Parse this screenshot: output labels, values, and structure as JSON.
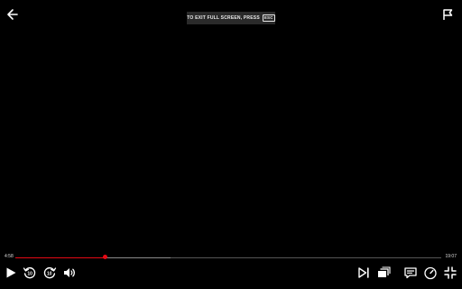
{
  "top_bar": {
    "back_icon": "arrow-left-icon",
    "report_icon": "flag-icon"
  },
  "exit_banner": {
    "text": "TO EXIT FULL SCREEN, PRESS",
    "key": "ESC"
  },
  "timeline": {
    "elapsed": "4:58",
    "remaining": "19:07",
    "played_fraction": 0.21,
    "buffered_fraction": 0.365,
    "colors": {
      "played": "#e50914",
      "buffered": "#8a8a8a",
      "track": "#555555"
    }
  },
  "controls": {
    "left": [
      "play-icon",
      "rewind-10-icon",
      "forward-10-icon",
      "volume-icon"
    ],
    "right": [
      "next-episode-icon",
      "episodes-icon",
      "subtitles-icon",
      "playback-speed-icon",
      "exit-fullscreen-icon"
    ]
  }
}
